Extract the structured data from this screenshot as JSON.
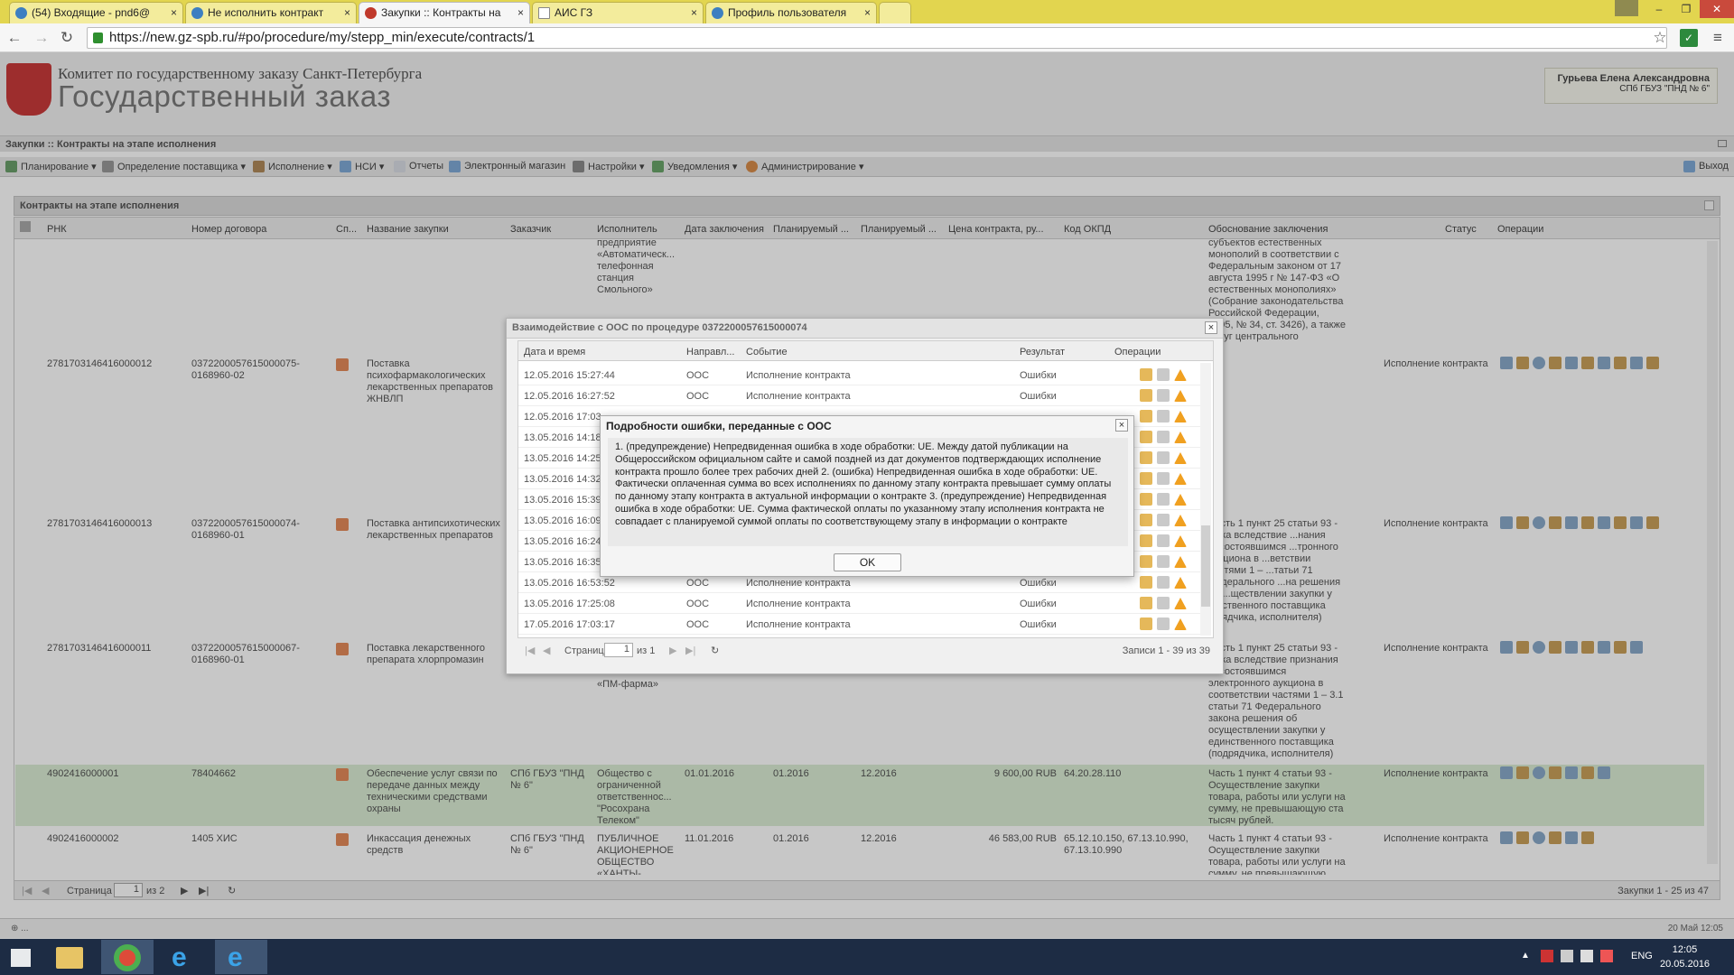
{
  "browser": {
    "tabs": [
      {
        "label": "(54) Входящие - pnd6@"
      },
      {
        "label": "Не исполнить контракт"
      },
      {
        "label": "Закупки :: Контракты на"
      },
      {
        "label": "АИС ГЗ"
      },
      {
        "label": "Профиль пользователя"
      }
    ],
    "url": "https://new.gz-spb.ru/#po/procedure/my/stepp_min/execute/contracts/1"
  },
  "header": {
    "org": "Комитет по государственному заказу Санкт-Петербурга",
    "app_name": "Государственный заказ",
    "user_name": "Гурьева Елена Александровна",
    "user_org": "СПб ГБУЗ \"ПНД № 6\""
  },
  "breadcrumb": "Закупки :: Контракты на этапе исполнения",
  "menu": {
    "items": [
      "Планирование",
      "Определение поставщика",
      "Исполнение",
      "НСИ",
      "Отчеты",
      "Электронный магазин",
      "Настройки",
      "Уведомления",
      "Администрирование"
    ],
    "exit": "Выход"
  },
  "panel_title": "Контракты на этапе исполнения",
  "grid": {
    "columns": [
      "РНК",
      "Номер договора",
      "Сп...",
      "Название закупки",
      "Заказчик",
      "Исполнитель",
      "Дата заключения",
      "Планируемый ...",
      "Планируемый ...",
      "Цена контракта, ру...",
      "Код ОКПД",
      "Обоснование заключения",
      "Статус",
      "Операции"
    ],
    "top_partial": {
      "executor": "предприятие «Автоматическ... телефонная станция Смольного»",
      "basis": "субъектов естественных монополий в соответствии с Федеральным законом от 17 августа 1995 г № 147-ФЗ «О естественных монополиях» (Собрание законодательства Российской Федерации, 1995, № 34, ст. 3426), а также услуг центрального депозитария"
    },
    "rows": [
      {
        "rnk": "2781703146416000012",
        "number": "0372200057615000075-0168960-02",
        "name": "Поставка психофармакологических лекарственных препаратов ЖНВЛП",
        "customer": "",
        "executor": "",
        "date": "",
        "plan1": "",
        "plan2": "",
        "price": "",
        "okpd": "",
        "basis": "",
        "status": "Исполнение контракта"
      },
      {
        "rnk": "2781703146416000013",
        "number": "0372200057615000074-0168960-01",
        "name": "Поставка антипсихотических лекарственных препаратов",
        "customer": "",
        "executor": "",
        "date": "",
        "plan1": "",
        "plan2": "",
        "price": "",
        "okpd": "",
        "basis": "Часть 1 пункт 25 статьи 93 - ...тка вследствие ...нания несостоявшимся ...тронного аукциона в ...ветствии частями 1 – ...татьи 71 Федерального ...на решения об ...ществлении закупки у ...иственного поставщика ...рядчика, исполнителя)",
        "status": "Исполнение контракта"
      },
      {
        "rnk": "2781703146416000011",
        "number": "0372200057615000067-0168960-01",
        "name": "Поставка лекарственного препарата хлорпромазин",
        "customer": "",
        "executor": "«ПМ-фарма»",
        "date": "",
        "plan1": "",
        "plan2": "",
        "price": "",
        "okpd": "",
        "basis": "Часть 1 пункт 25 статьи 93 - ...тка вследствие признания несостоявшимся электронного аукциона в соответствии частями 1 – 3.1 статьи 71 Федерального закона решения об осуществлении закупки у единственного поставщика (подрядчика, исполнителя)",
        "status": "Исполнение контракта"
      },
      {
        "rnk": "4902416000001",
        "number": "78404662",
        "name": "Обеспечение услуг связи по передаче данных между техническими средствами охраны",
        "customer": "СПб ГБУЗ \"ПНД № 6\"",
        "executor": "Общество с ограниченной ответственнос... \"Росохрана Телеком\"",
        "date": "01.01.2016",
        "plan1": "01.2016",
        "plan2": "12.2016",
        "price": "9 600,00 RUB",
        "okpd": "64.20.28.110",
        "basis": "Часть 1 пункт 4 статьи 93 - Осуществление закупки товара, работы или услуги на сумму, не превышающую ста тысяч рублей.",
        "status": "Исполнение контракта"
      },
      {
        "rnk": "4902416000002",
        "number": "1405 ХИС",
        "name": "Инкассация денежных средств",
        "customer": "СПб ГБУЗ \"ПНД № 6\"",
        "executor": "ПУБЛИЧНОЕ АКЦИОНЕРНОЕ ОБЩЕСТВО «ХАНТЫ-",
        "date": "11.01.2016",
        "plan1": "01.2016",
        "plan2": "12.2016",
        "price": "46 583,00 RUB",
        "okpd": "65.12.10.150, 67.13.10.990, 67.13.10.990",
        "basis": "Часть 1 пункт 4 статьи 93 - Осуществление закупки товара, работы или услуги на сумму, не превышающую",
        "status": "Исполнение контракта"
      }
    ]
  },
  "pager": {
    "page_label": "Страница",
    "page": "1",
    "of": "из 2",
    "summary": "Закупки 1 - 25 из 47"
  },
  "status_bar": {
    "left": "⊕ ...",
    "right": "20 Май 12:05"
  },
  "dialog_ooc": {
    "title": "Взаимодействие с ООС по процедуре 0372200057615000074",
    "columns": [
      "Дата и время",
      "Направл...",
      "Событие",
      "Результат",
      "Операции"
    ],
    "rows": [
      {
        "dt": "12.05.2016 15:27:44",
        "dir": "ООС",
        "event": "Исполнение контракта",
        "result": "Ошибки"
      },
      {
        "dt": "12.05.2016 16:27:52",
        "dir": "ООС",
        "event": "Исполнение контракта",
        "result": "Ошибки"
      },
      {
        "dt": "12.05.2016 17:03",
        "dir": "",
        "event": "",
        "result": ""
      },
      {
        "dt": "13.05.2016 14:18",
        "dir": "",
        "event": "",
        "result": ""
      },
      {
        "dt": "13.05.2016 14:25",
        "dir": "",
        "event": "",
        "result": ""
      },
      {
        "dt": "13.05.2016 14:32",
        "dir": "",
        "event": "",
        "result": ""
      },
      {
        "dt": "13.05.2016 15:39",
        "dir": "",
        "event": "",
        "result": ""
      },
      {
        "dt": "13.05.2016 16:09",
        "dir": "",
        "event": "",
        "result": ""
      },
      {
        "dt": "13.05.2016 16:24",
        "dir": "",
        "event": "",
        "result": ""
      },
      {
        "dt": "13.05.2016 16:35",
        "dir": "",
        "event": "",
        "result": ""
      },
      {
        "dt": "13.05.2016 16:53:52",
        "dir": "ООС",
        "event": "Исполнение контракта",
        "result": "Ошибки"
      },
      {
        "dt": "13.05.2016 17:25:08",
        "dir": "ООС",
        "event": "Исполнение контракта",
        "result": "Ошибки"
      },
      {
        "dt": "17.05.2016 17:03:17",
        "dir": "ООС",
        "event": "Исполнение контракта",
        "result": "Ошибки"
      }
    ],
    "pager": {
      "label": "Страница",
      "page": "1",
      "of": "из 1",
      "summary": "Записи 1 - 39 из 39"
    }
  },
  "dialog_error": {
    "title": "Подробности ошибки, переданные с ООС",
    "message": "1. (предупреждение) Непредвиденная ошибка в ходе обработки: UE. Между датой публикации на Общероссийском официальном сайте и самой поздней из дат документов подтверждающих исполнение контракта прошло более трех рабочих дней 2. (ошибка) Непредвиденная ошибка в ходе обработки: UE. Фактически оплаченная сумма во всех исполнениях по данному этапу контракта превышает сумму оплаты по данному этапу контракта в актуальной информации о контракте 3. (предупреждение) Непредвиденная ошибка в ходе обработки: UE. Сумма фактической оплаты по указанному этапу исполнения контракта не совпадает с планируемой суммой оплаты по соответствующему этапу в информации о контракте",
    "ok": "OK"
  },
  "taskbar": {
    "lang": "ENG",
    "time": "12:05",
    "date": "20.05.2016"
  }
}
